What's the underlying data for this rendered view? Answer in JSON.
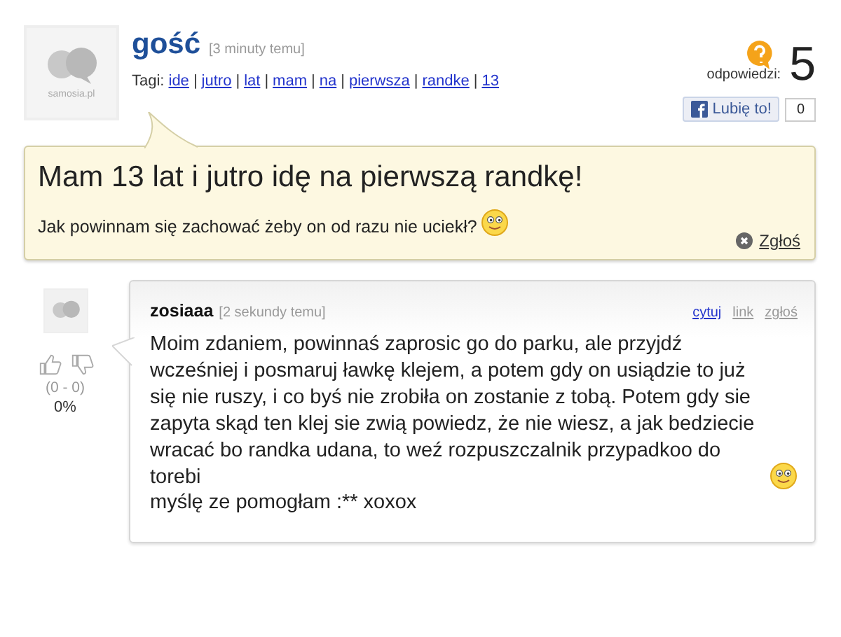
{
  "question": {
    "avatar_label": "samosia.pl",
    "author": "gość",
    "time": "[3 minuty temu]",
    "tags_label": "Tagi:",
    "tags": [
      "ide",
      "jutro",
      "lat",
      "mam",
      "na",
      "pierwsza",
      "randke",
      "13"
    ],
    "separators": [
      "|",
      "|",
      "|",
      "|",
      "|",
      "|",
      "|"
    ],
    "answers_label": "odpowiedzi:",
    "answers_count": "5",
    "like_label": "Lubię to!",
    "like_count": "0",
    "title": "Mam 13 lat i jutro idę na pierwszą randkę!",
    "body": "Jak powinnam się zachować żeby on od razu nie uciekł?",
    "report": "Zgłoś"
  },
  "answers": [
    {
      "author": "zosiaaa",
      "time": "[2 sekundy temu]",
      "votes": "(0 - 0)",
      "percent": "0%",
      "links": [
        {
          "label": "cytuj",
          "active": true
        },
        {
          "label": "link",
          "active": false
        },
        {
          "label": "zgłoś",
          "active": false
        }
      ],
      "body": "Moim zdaniem, powinnaś zaprosic go do parku, ale przyjdź wcześniej i posmaruj ławkę klejem, a potem gdy on usiądzie to już się nie ruszy, i co byś nie zrobiła on zostanie z tobą. Potem gdy sie zapyta skąd ten klej sie zwią powiedz, że nie wiesz, a jak bedziecie wracać bo randka udana, to weź rozpuszczalnik przypadkoo do torebi",
      "closing": "myślę ze pomogłam :** xoxox"
    }
  ]
}
